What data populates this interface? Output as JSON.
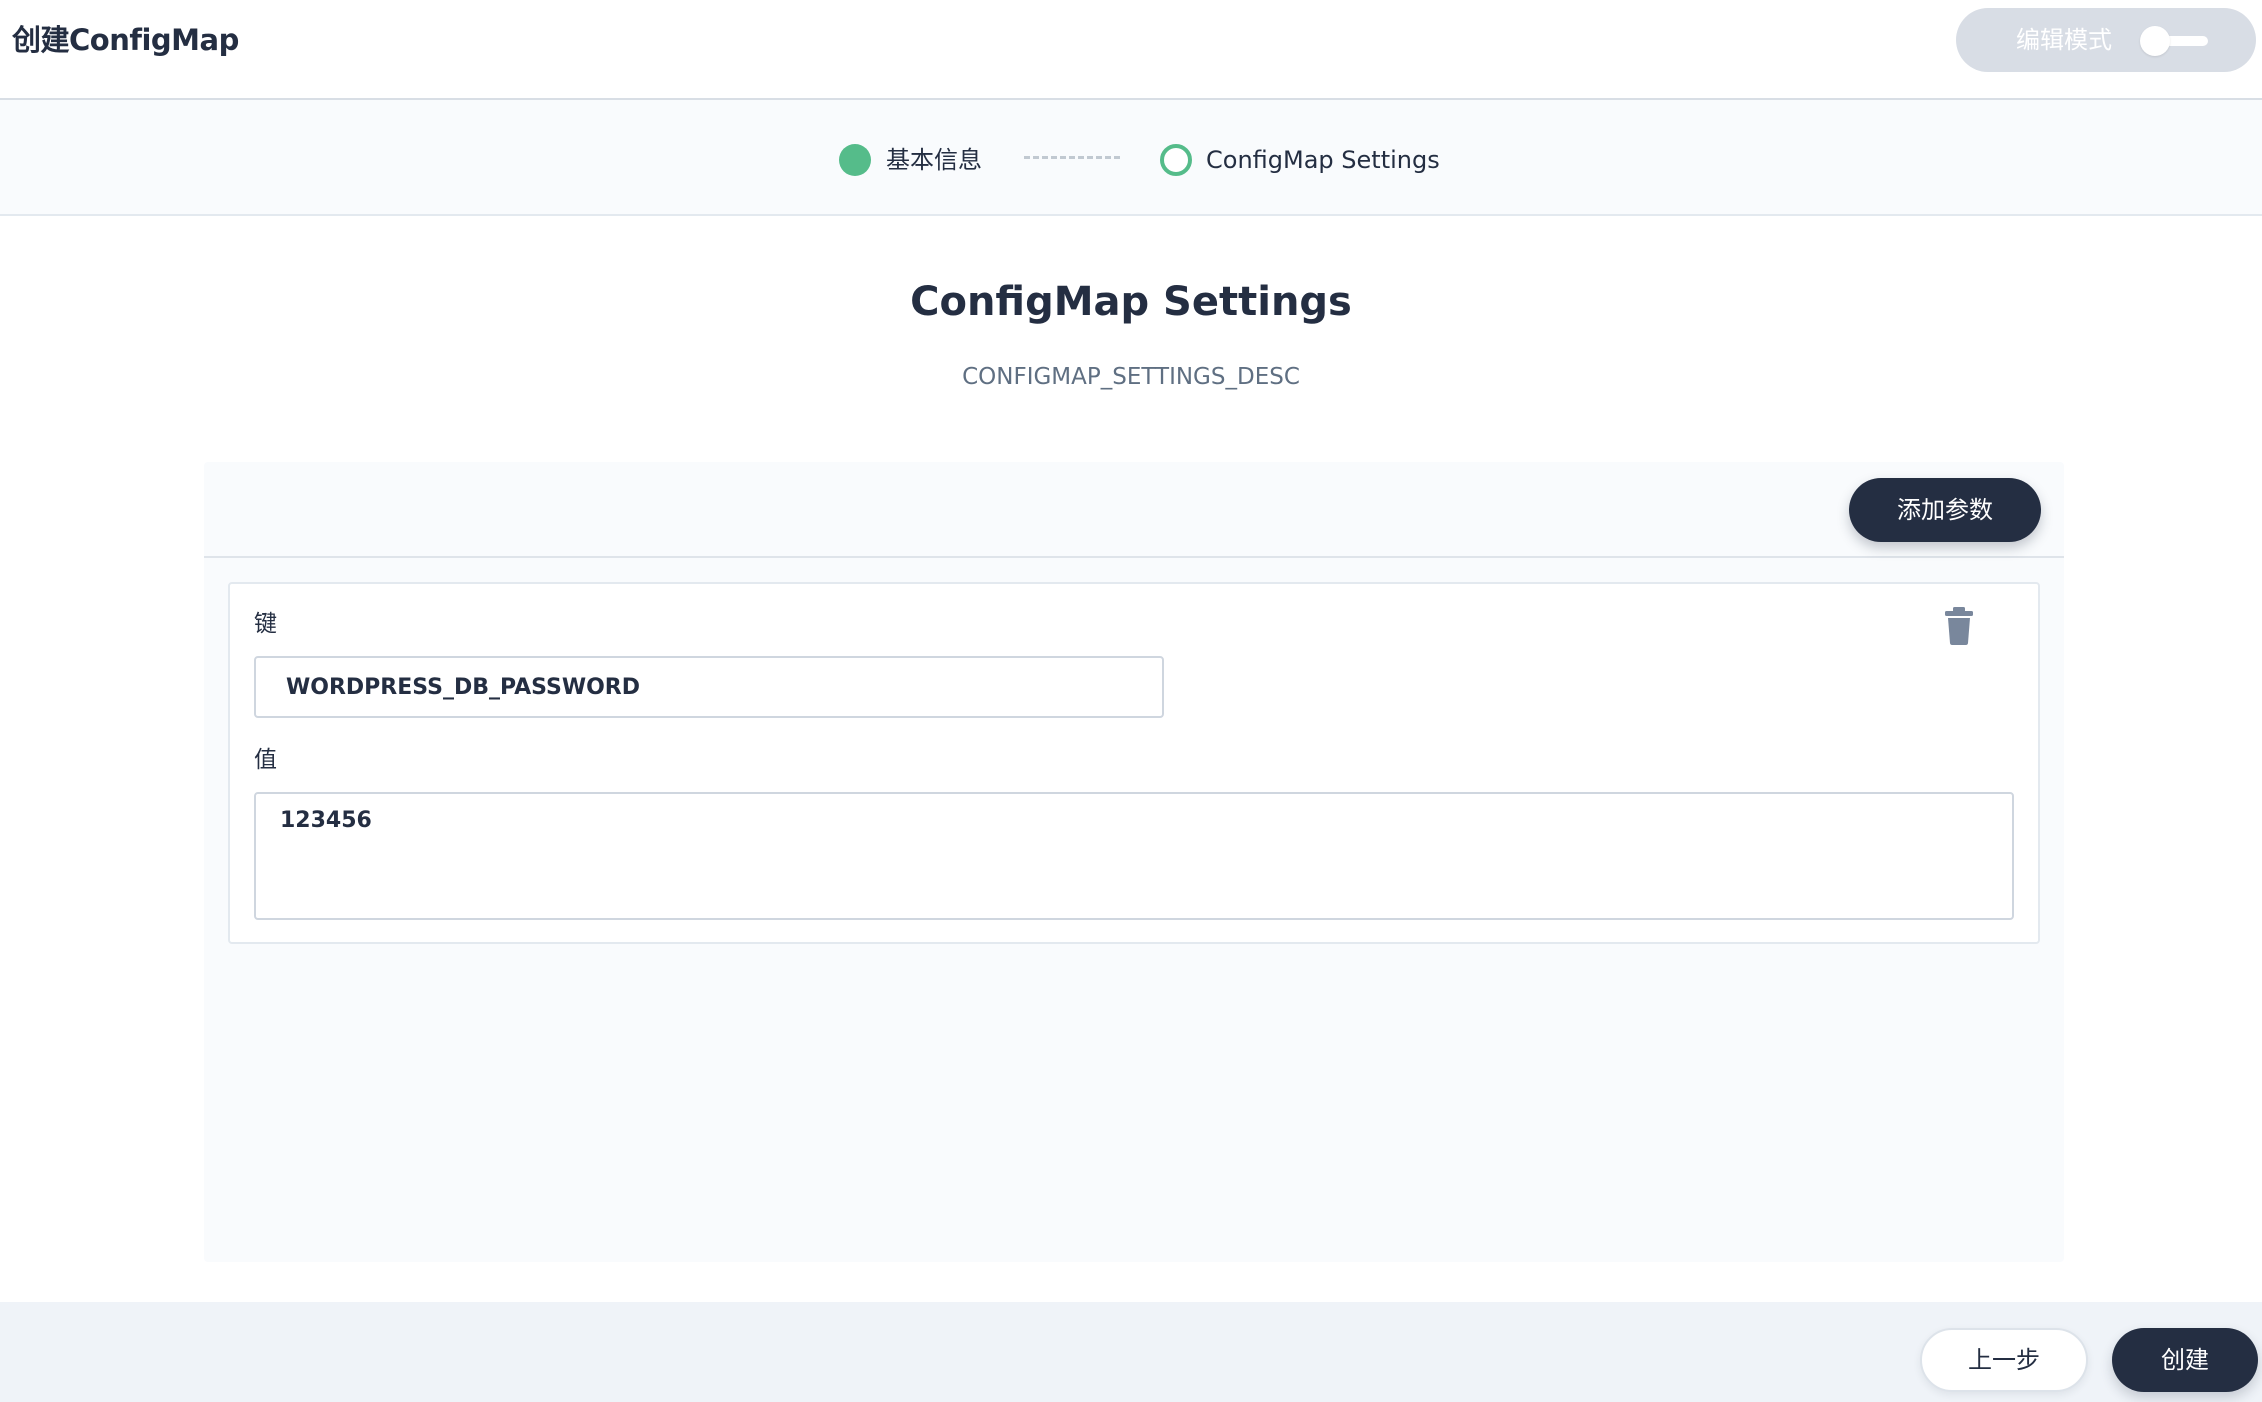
{
  "header": {
    "title": "创建ConfigMap",
    "edit_mode_label": "编辑模式"
  },
  "steps": [
    {
      "label": "基本信息",
      "status": "done"
    },
    {
      "label": "ConfigMap Settings",
      "status": "current"
    }
  ],
  "main": {
    "title": "ConfigMap Settings",
    "description": "CONFIGMAP_SETTINGS_DESC"
  },
  "panel": {
    "add_param_label": "添加参数",
    "params": [
      {
        "key_label": "键",
        "key_value": "WORDPRESS_DB_PASSWORD",
        "value_label": "值",
        "value_value": "123456"
      }
    ]
  },
  "footer": {
    "prev_label": "上一步",
    "create_label": "创建"
  },
  "colors": {
    "primary_dark": "#242e42",
    "success_green": "#55bc8a",
    "disabled_gray": "#d8dde5",
    "panel_bg": "#f9fbfd",
    "footer_bg": "#eff3f8"
  },
  "icons": {
    "delete": "trash-icon",
    "step_done": "filled-circle-icon",
    "step_current": "ring-circle-icon"
  }
}
